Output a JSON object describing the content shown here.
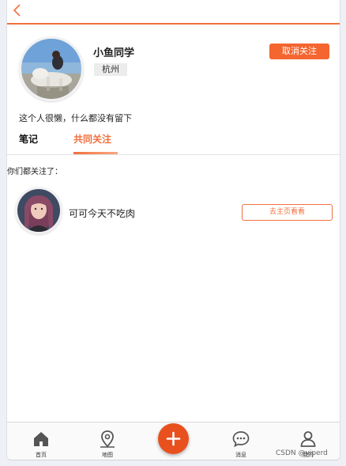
{
  "profile": {
    "name": "小鱼同学",
    "city": "杭州",
    "unfollow_label": "取消关注",
    "bio": "这个人很懒，什么都没有留下"
  },
  "tabs": [
    {
      "label": "笔记",
      "active": false
    },
    {
      "label": "共同关注",
      "active": true
    }
  ],
  "mutual": {
    "heading": "你们都关注了：",
    "users": [
      {
        "name": "可可今天不吃肉",
        "action_label": "去主页看看"
      }
    ]
  },
  "bottom_nav": {
    "items": [
      {
        "label": "首页",
        "icon": "home-icon"
      },
      {
        "label": "地图",
        "icon": "map-pin-icon"
      },
      {
        "label": "消息",
        "icon": "message-icon"
      },
      {
        "label": "我的",
        "icon": "user-icon"
      }
    ],
    "fab_icon": "plus-icon"
  },
  "watermark": "CSDN @viperd",
  "colors": {
    "accent": "#f2703e",
    "button": "#f5652f",
    "fab": "#e8501e"
  }
}
